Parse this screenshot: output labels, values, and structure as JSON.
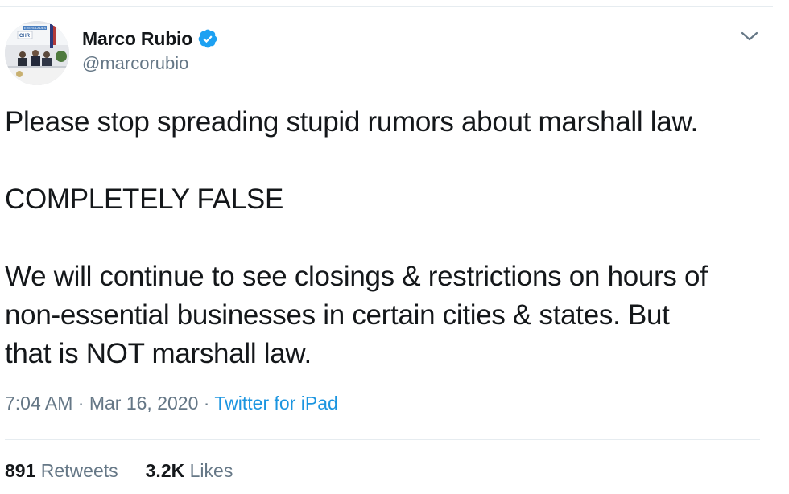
{
  "author": {
    "display_name": "Marco Rubio",
    "handle": "@marcorubio",
    "verified_icon": "verified-badge-icon"
  },
  "avatar": {
    "sign_text": "EVERGLADES",
    "logo_text": "CHR"
  },
  "tweet": {
    "line1": "Please stop spreading stupid rumors about marshall law.",
    "line2": "COMPLETELY FALSE",
    "line3a": "We will continue to see closings & restrictions on hours of",
    "line3b": "non-essential businesses in certain cities & states. But",
    "line3c": "that is NOT marshall law."
  },
  "meta": {
    "time": "7:04 AM",
    "sep1": " · ",
    "date": "Mar 16, 2020",
    "sep2": " · ",
    "source": "Twitter for iPad"
  },
  "stats": {
    "retweets_count": "891",
    "retweets_label": "Retweets",
    "likes_count": "3.2K",
    "likes_label": "Likes"
  },
  "colors": {
    "accent": "#1b95e0",
    "secondary_text": "#657786",
    "primary_text": "#14171a",
    "divider": "#e6ecf0"
  }
}
